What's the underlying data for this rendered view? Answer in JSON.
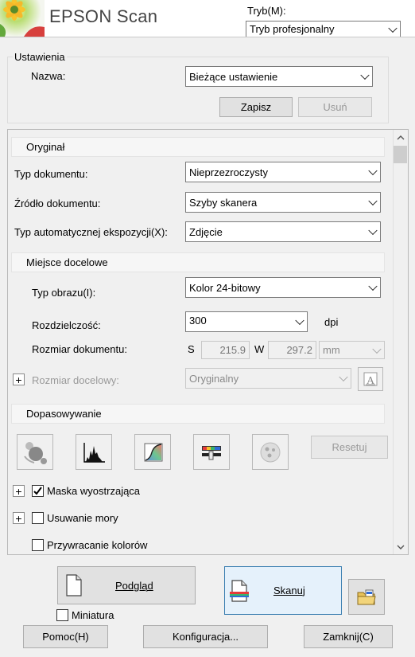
{
  "app": {
    "title": "EPSON Scan",
    "mode_label": "Tryb(M):",
    "mode_value": "Tryb profesjonalny"
  },
  "settings": {
    "group_label": "Ustawienia",
    "name_label": "Nazwa:",
    "name_value": "Bieżące ustawienie",
    "save_label": "Zapisz",
    "delete_label": "Usuń"
  },
  "original": {
    "header": "Oryginał",
    "doc_type_label": "Typ dokumentu:",
    "doc_type_value": "Nieprzezroczysty",
    "doc_source_label": "Źródło dokumentu:",
    "doc_source_value": "Szyby skanera",
    "auto_exposure_label": "Typ automatycznej ekspozycji(X):",
    "auto_exposure_value": "Zdjęcie"
  },
  "destination": {
    "header": "Miejsce docelowe",
    "image_type_label": "Typ obrazu(I):",
    "image_type_value": "Kolor 24-bitowy",
    "resolution_label": "Rozdzielczość:",
    "resolution_value": "300",
    "resolution_unit": "dpi",
    "doc_size_label": "Rozmiar dokumentu:",
    "width_prefix": "S",
    "width_value": "215.9",
    "height_prefix": "W",
    "height_value": "297.2",
    "unit_value": "mm",
    "target_size_label": "Rozmiar docelowy:",
    "target_size_value": "Oryginalny"
  },
  "adjustments": {
    "header": "Dopasowywanie",
    "reset_label": "Resetuj",
    "unsharp_label": "Maska wyostrzająca",
    "unsharp_checked": true,
    "descreen_label": "Usuwanie mory",
    "descreen_checked": false,
    "color_restore_label": "Przywracanie kolorów",
    "color_restore_checked": false
  },
  "actions": {
    "preview_label": "Podgląd",
    "scan_label": "Skanuj",
    "thumbnail_label": "Miniatura",
    "thumbnail_checked": false,
    "help_label": "Pomoc(H)",
    "config_label": "Konfiguracja...",
    "close_label": "Zamknij(C)"
  },
  "icons": {
    "logo": "epson-flower-logo",
    "backlight": "backlight-correction-icon",
    "histogram": "histogram-icon",
    "tone": "tone-correction-icon",
    "color_palette": "color-palette-icon",
    "dust": "dust-removal-icon",
    "target_size": "target-size-icon",
    "preview": "document-preview-icon",
    "scan": "scan-icon",
    "folder": "file-save-folder-icon"
  }
}
